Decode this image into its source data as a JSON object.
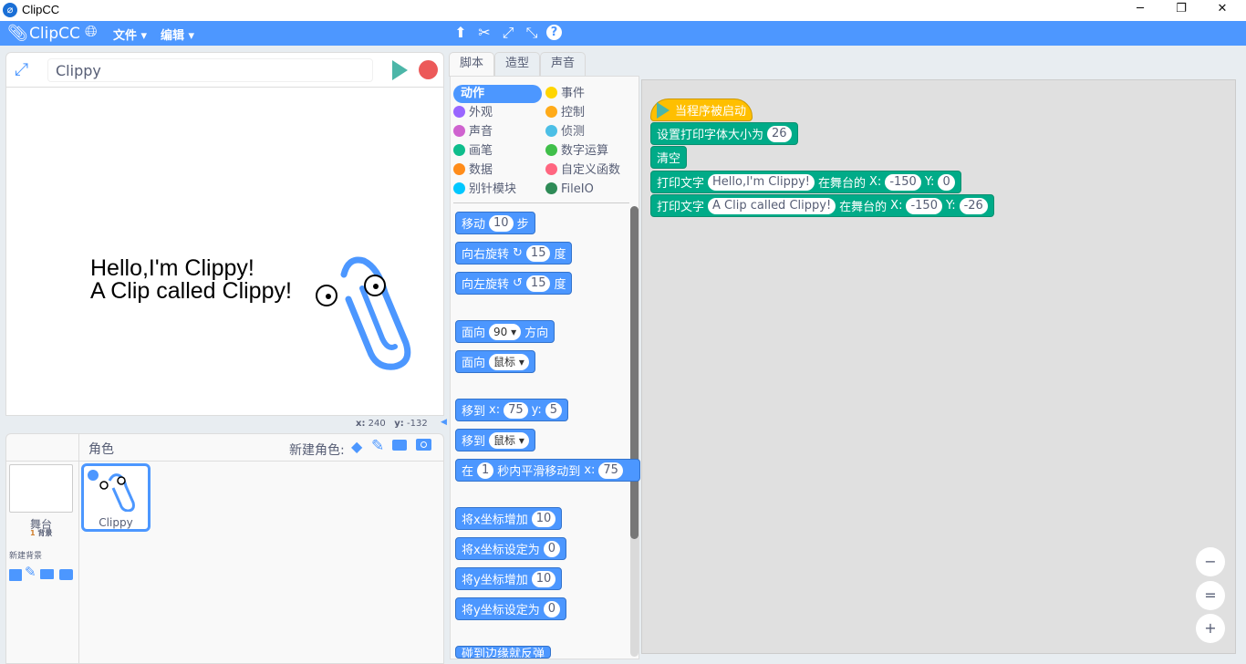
{
  "window": {
    "title": "ClipCC",
    "minimize": "─",
    "restore": "❐",
    "close": "✕"
  },
  "menubar": {
    "brand": "ClipCC",
    "file": "文件",
    "edit": "编辑",
    "tools": {
      "duplicate": "⬆",
      "cut": "✂",
      "grow": "⤢",
      "shrink": "⤡",
      "help": "?"
    }
  },
  "stage": {
    "sprite_name": "Clippy",
    "line1": "Hello,I'm Clippy!",
    "line2": "A Clip called Clippy!",
    "x_label": "x:",
    "x": "240",
    "y_label": "y:",
    "y": "-132"
  },
  "sprites": {
    "header": "角色",
    "new_sprite": "新建角色:",
    "stage_label": "舞台",
    "backdrop_count": "1",
    "backdrop_label": "背景",
    "new_backdrop": "新建背景",
    "items": [
      {
        "name": "Clippy"
      }
    ]
  },
  "tabs": [
    {
      "label": "脚本"
    },
    {
      "label": "造型"
    },
    {
      "label": "声音"
    }
  ],
  "categories": [
    {
      "label": "动作",
      "color": "#4c97ff",
      "selected": true
    },
    {
      "label": "事件",
      "color": "#ffd500"
    },
    {
      "label": "外观",
      "color": "#9966ff"
    },
    {
      "label": "控制",
      "color": "#ffab19"
    },
    {
      "label": "声音",
      "color": "#cf63cf"
    },
    {
      "label": "侦测",
      "color": "#4cbfe6"
    },
    {
      "label": "画笔",
      "color": "#0fbd8c"
    },
    {
      "label": "数字运算",
      "color": "#40bf4a"
    },
    {
      "label": "数据",
      "color": "#ff8c1a"
    },
    {
      "label": "自定义函数",
      "color": "#ff6680"
    },
    {
      "label": "别针模块",
      "color": "#00c7ff"
    },
    {
      "label": "FileIO",
      "color": "#2e8b57"
    }
  ],
  "palette_blocks": [
    [
      {
        "t": "移动"
      },
      {
        "i": "10"
      },
      {
        "t": "步"
      }
    ],
    [
      {
        "t": "向右旋转"
      },
      {
        "t": "↻"
      },
      {
        "i": "15"
      },
      {
        "t": "度"
      }
    ],
    [
      {
        "t": "向左旋转"
      },
      {
        "t": "↺"
      },
      {
        "i": "15"
      },
      {
        "t": "度"
      }
    ],
    [
      {
        "t": "面向"
      },
      {
        "d": "90 ▾"
      },
      {
        "t": "方向"
      }
    ],
    [
      {
        "t": "面向"
      },
      {
        "d": "鼠标 ▾"
      }
    ],
    [
      {
        "t": "移到"
      },
      {
        "t": "x:"
      },
      {
        "i": "75"
      },
      {
        "t": "y:"
      },
      {
        "i": "5"
      }
    ],
    [
      {
        "t": "移到"
      },
      {
        "d": "鼠标 ▾"
      }
    ],
    [
      {
        "t": "在"
      },
      {
        "i": "1"
      },
      {
        "t": "秒内平滑移动到"
      },
      {
        "t": "x:"
      },
      {
        "i": "75"
      }
    ],
    [
      {
        "t": "将x坐标增加"
      },
      {
        "i": "10"
      }
    ],
    [
      {
        "t": "将x坐标设定为"
      },
      {
        "i": "0"
      }
    ],
    [
      {
        "t": "将y坐标增加"
      },
      {
        "i": "10"
      }
    ],
    [
      {
        "t": "将y坐标设定为"
      },
      {
        "i": "0"
      }
    ],
    [
      {
        "t": "碰到边缘就反弹"
      }
    ]
  ],
  "script_blocks": [
    [
      {
        "t": "当程序被启动"
      }
    ],
    [
      {
        "t": "设置打印字体大小为"
      },
      {
        "i": "26"
      }
    ],
    [
      {
        "t": "清空"
      }
    ],
    [
      {
        "t": "打印文字"
      },
      {
        "i": "Hello,I'm Clippy!"
      },
      {
        "t": "在舞台的"
      },
      {
        "t": "X:"
      },
      {
        "i": "-150"
      },
      {
        "t": "Y:"
      },
      {
        "i": "0"
      }
    ],
    [
      {
        "t": "打印文字"
      },
      {
        "i": "A Clip called Clippy!"
      },
      {
        "t": "在舞台的"
      },
      {
        "t": "X:"
      },
      {
        "i": "-150"
      },
      {
        "t": "Y:"
      },
      {
        "i": "-26"
      }
    ]
  ],
  "zoom": {
    "out": "−",
    "reset": "=",
    "in": "+"
  },
  "colors": {
    "accent": "#4d97ff",
    "motion": "#4c97ff",
    "pen": "#00ab88",
    "event": "#ffbf00",
    "green_flag": "#4cb6a8",
    "stop": "#ec5959"
  }
}
